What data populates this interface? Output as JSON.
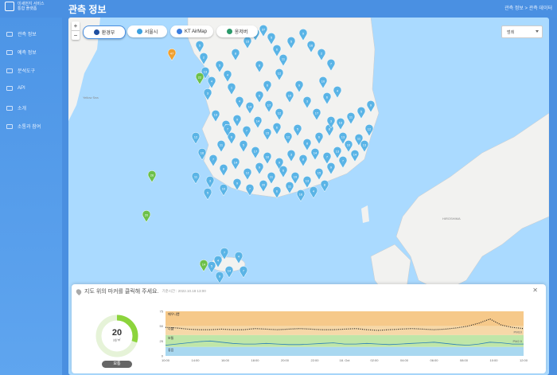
{
  "header": {
    "brand_line1": "미세먼지 서비스",
    "brand_line2": "통합 플랫폼",
    "title": "관측 정보",
    "breadcrumb": "관측 정보  >  관측 데이터"
  },
  "sidebar": {
    "items": [
      {
        "label": "관측 정보",
        "icon": "observation-icon"
      },
      {
        "label": "예측 정보",
        "icon": "forecast-icon"
      },
      {
        "label": "분석도구",
        "icon": "analysis-icon"
      },
      {
        "label": "API",
        "icon": "api-icon"
      },
      {
        "label": "소개",
        "icon": "info-icon"
      },
      {
        "label": "소통과 참여",
        "icon": "community-icon"
      }
    ]
  },
  "map": {
    "zoom_in": "+",
    "zoom_out": "−",
    "sources": [
      {
        "label": "환경부",
        "color": "#1f4fa0",
        "active": true
      },
      {
        "label": "서울시",
        "color": "#3ba0e0",
        "active": false
      },
      {
        "label": "KT AirMap",
        "color": "#3a7de0",
        "active": false
      },
      {
        "label": "옹저버",
        "color": "#2a9a6a",
        "active": false
      }
    ],
    "layer_select": "범례",
    "colors": {
      "good": "#6cc04a",
      "moderate": "#5ab4e6",
      "orange": "#f0a030",
      "land": "#f2f2f0",
      "sea": "#aadaff"
    },
    "markers": [
      {
        "n": "2"
      },
      {
        "n": "5"
      },
      {
        "n": "13"
      },
      {
        "n": "4"
      },
      {
        "n": "3"
      },
      {
        "n": "5"
      },
      {
        "n": "4"
      },
      {
        "n": "1"
      },
      {
        "n": "8"
      },
      {
        "n": "15"
      },
      {
        "n": "26"
      },
      {
        "n": "37"
      },
      {
        "n": "5"
      },
      {
        "n": "6"
      },
      {
        "n": "11"
      },
      {
        "n": "5"
      },
      {
        "n": "9"
      },
      {
        "n": "16"
      },
      {
        "n": "2"
      },
      {
        "n": "7"
      },
      {
        "n": "4"
      },
      {
        "n": "14"
      },
      {
        "n": "6"
      },
      {
        "n": "17"
      },
      {
        "n": "12"
      },
      {
        "n": "10"
      },
      {
        "n": "9"
      },
      {
        "n": "3"
      },
      {
        "n": "17"
      },
      {
        "n": "6"
      },
      {
        "n": "4"
      },
      {
        "n": "13"
      },
      {
        "n": "5"
      },
      {
        "n": "9"
      },
      {
        "n": "7"
      },
      {
        "n": "14"
      },
      {
        "n": "15"
      },
      {
        "n": "6"
      },
      {
        "n": "12"
      },
      {
        "n": "5"
      },
      {
        "n": "8"
      },
      {
        "n": "6"
      },
      {
        "n": "8"
      },
      {
        "n": "13"
      },
      {
        "n": "11"
      },
      {
        "n": "5"
      },
      {
        "n": "9"
      },
      {
        "n": "12"
      },
      {
        "n": "11"
      },
      {
        "n": "10"
      },
      {
        "n": "13"
      },
      {
        "n": "7"
      },
      {
        "n": "14"
      },
      {
        "n": "8"
      },
      {
        "n": "3"
      },
      {
        "n": "9"
      },
      {
        "n": "16"
      },
      {
        "n": "17"
      },
      {
        "n": "5"
      },
      {
        "n": "6"
      },
      {
        "n": "11"
      },
      {
        "n": "7"
      },
      {
        "n": "8"
      },
      {
        "n": "14"
      },
      {
        "n": "12"
      },
      {
        "n": "9"
      },
      {
        "n": "11"
      },
      {
        "n": "6"
      },
      {
        "n": "19"
      },
      {
        "n": "13"
      },
      {
        "n": "15"
      },
      {
        "n": "9"
      },
      {
        "n": "7"
      },
      {
        "n": "14"
      },
      {
        "n": "13"
      },
      {
        "n": "16"
      },
      {
        "n": "12"
      },
      {
        "n": "3"
      },
      {
        "n": "10"
      },
      {
        "n": "9"
      },
      {
        "n": "7"
      },
      {
        "n": "20"
      },
      {
        "n": "6"
      },
      {
        "n": "11"
      },
      {
        "n": "16"
      },
      {
        "n": "4"
      },
      {
        "n": "8"
      },
      {
        "n": "11"
      },
      {
        "n": "5"
      },
      {
        "n": "7"
      },
      {
        "n": "10"
      },
      {
        "n": "3"
      },
      {
        "n": "13"
      },
      {
        "n": "7"
      },
      {
        "n": "4"
      },
      {
        "n": "14"
      },
      {
        "n": "4"
      },
      {
        "n": "7"
      },
      {
        "n": "5"
      },
      {
        "n": "9"
      },
      {
        "n": "12"
      },
      {
        "n": "8"
      },
      {
        "n": "6"
      }
    ],
    "special_markers": [
      {
        "n": "47",
        "level": "orange"
      },
      {
        "n": "22",
        "level": "good"
      },
      {
        "n": "26",
        "level": "good"
      },
      {
        "n": "20",
        "level": "good"
      },
      {
        "n": "14",
        "level": "good"
      }
    ]
  },
  "panel": {
    "title": "지도 위의 마커를 클릭해 주세요.",
    "time": "기준시간 : 2022.10.18 13:00",
    "close": "✕",
    "gauge_value": "20",
    "gauge_unit": "㎍/㎥",
    "gauge_status": "보통",
    "gauge_level": 0.3,
    "gauge_color": "#8cd43c"
  },
  "chart_data": {
    "type": "line",
    "x": [
      "10:00",
      "14:00",
      "16:00",
      "18:00",
      "20:00",
      "22:00",
      "18. Oct",
      "02:00",
      "04:00",
      "06:00",
      "08:00",
      "10:00",
      "12:00"
    ],
    "ylim": [
      0,
      75
    ],
    "yticks": [
      "75",
      "50",
      "25",
      "0"
    ],
    "zones": [
      {
        "name": "매우나쁨",
        "from": 50,
        "to": 75,
        "color": "#f6c98a"
      },
      {
        "name": "나쁨",
        "from": 35,
        "to": 50,
        "color": "#f6d8a8"
      },
      {
        "name": "보통",
        "from": 15,
        "to": 35,
        "color": "#bfe6a8"
      },
      {
        "name": "좋음",
        "from": 0,
        "to": 15,
        "color": "#a9d8f0"
      }
    ],
    "series": [
      {
        "name": "PM10",
        "style": "dotted",
        "values": [
          48,
          47,
          45,
          44,
          44,
          45,
          44,
          44,
          46,
          45,
          44,
          45,
          46,
          45,
          44,
          44,
          45,
          46,
          44,
          43,
          44,
          45,
          46,
          45,
          44,
          45,
          47,
          50,
          55,
          62,
          52,
          48,
          46
        ]
      },
      {
        "name": "PM2.5",
        "style": "solid",
        "values": [
          18,
          20,
          22,
          24,
          25,
          23,
          21,
          20,
          20,
          21,
          20,
          19,
          19,
          20,
          21,
          22,
          20,
          20,
          21,
          20,
          19,
          20,
          21,
          22,
          23,
          21,
          19,
          18,
          20,
          23,
          22,
          20,
          20
        ]
      }
    ]
  }
}
